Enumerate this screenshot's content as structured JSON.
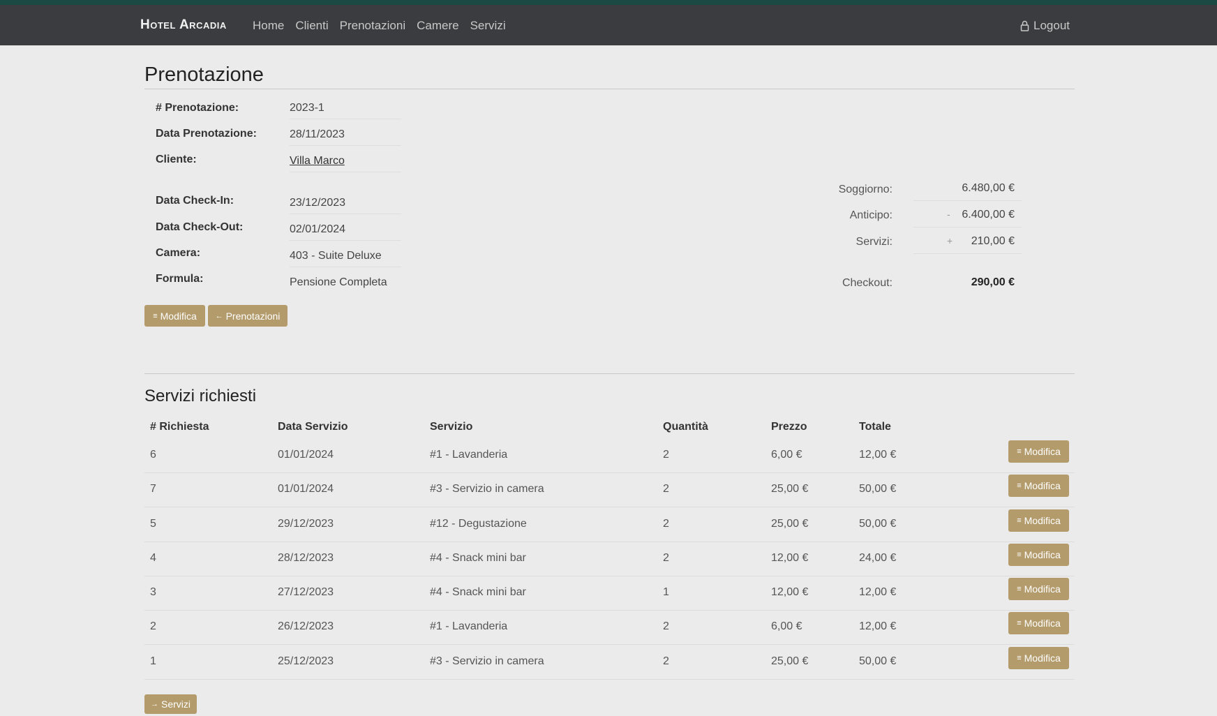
{
  "brand": "Hotel Arcadia",
  "nav": [
    {
      "label": "Home"
    },
    {
      "label": "Clienti"
    },
    {
      "label": "Prenotazioni"
    },
    {
      "label": "Camere"
    },
    {
      "label": "Servizi"
    }
  ],
  "logout": {
    "label": "Logout",
    "icon": "lock-icon"
  },
  "page_title": "Prenotazione",
  "details": {
    "numero": {
      "label": "# Prenotazione:",
      "value": "2023-1"
    },
    "data": {
      "label": "Data Prenotazione:",
      "value": "28/11/2023"
    },
    "cliente": {
      "label": "Cliente:",
      "value": "Villa Marco"
    },
    "checkin": {
      "label": "Data Check-In:",
      "value": "23/12/2023"
    },
    "checkout": {
      "label": "Data Check-Out:",
      "value": "02/01/2024"
    },
    "camera": {
      "label": "Camera:",
      "value": "403 - Suite Deluxe"
    },
    "formula": {
      "label": "Formula:",
      "value": "Pensione Completa"
    }
  },
  "summary": {
    "soggiorno": {
      "label": "Soggiorno:",
      "value": "6.480,00 €"
    },
    "anticipo": {
      "label": "Anticipo:",
      "sign": "-",
      "value": "6.400,00 €"
    },
    "servizi": {
      "label": "Servizi:",
      "sign": "+",
      "value": "210,00 €"
    },
    "checkout": {
      "label": "Checkout:",
      "value": "290,00 €"
    }
  },
  "buttons": {
    "modifica": "Modifica",
    "prenotazioni": "Prenotazioni",
    "servizi": "Servizi"
  },
  "services_title": "Servizi richiesti",
  "table": {
    "headers": [
      "# Richiesta",
      "Data Servizio",
      "Servizio",
      "Quantità",
      "Prezzo",
      "Totale"
    ],
    "rows": [
      {
        "id": "6",
        "date": "01/01/2024",
        "service": "#1 - Lavanderia",
        "qty": "2",
        "price": "6,00 €",
        "total": "12,00 €",
        "action": "Modifica"
      },
      {
        "id": "7",
        "date": "01/01/2024",
        "service": "#3 - Servizio in camera",
        "qty": "2",
        "price": "25,00 €",
        "total": "50,00 €",
        "action": "Modifica"
      },
      {
        "id": "5",
        "date": "29/12/2023",
        "service": "#12 - Degustazione",
        "qty": "2",
        "price": "25,00 €",
        "total": "50,00 €",
        "action": "Modifica"
      },
      {
        "id": "4",
        "date": "28/12/2023",
        "service": "#4 - Snack mini bar",
        "qty": "2",
        "price": "12,00 €",
        "total": "24,00 €",
        "action": "Modifica"
      },
      {
        "id": "3",
        "date": "27/12/2023",
        "service": "#4 - Snack mini bar",
        "qty": "1",
        "price": "12,00 €",
        "total": "12,00 €",
        "action": "Modifica"
      },
      {
        "id": "2",
        "date": "26/12/2023",
        "service": "#1 - Lavanderia",
        "qty": "2",
        "price": "6,00 €",
        "total": "12,00 €",
        "action": "Modifica"
      },
      {
        "id": "1",
        "date": "25/12/2023",
        "service": "#3 - Servizio in camera",
        "qty": "2",
        "price": "25,00 €",
        "total": "50,00 €",
        "action": "Modifica"
      }
    ]
  }
}
